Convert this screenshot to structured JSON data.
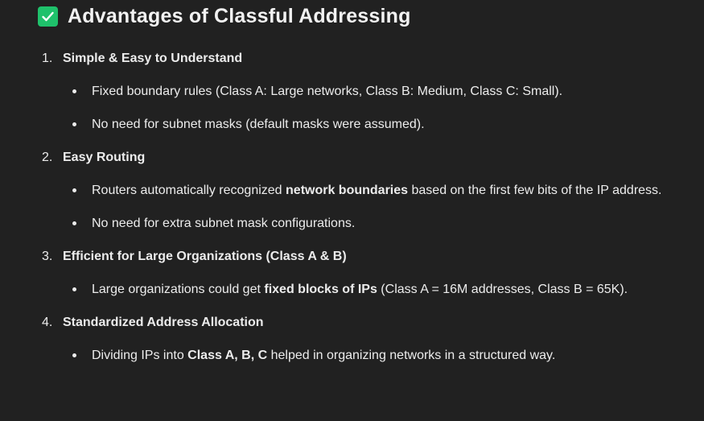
{
  "heading": {
    "icon": "check-mark-button-icon",
    "text": "Advantages of Classful Addressing",
    "icon_color": "#1fc16b"
  },
  "items": [
    {
      "number": "1.",
      "title": "Simple & Easy to Understand",
      "bullets": [
        [
          {
            "t": "Fixed boundary rules (Class A: Large networks, Class B: Medium, Class C: Small)."
          }
        ],
        [
          {
            "t": "No need for subnet masks (default masks were assumed)."
          }
        ]
      ]
    },
    {
      "number": "2.",
      "title": "Easy Routing",
      "bullets": [
        [
          {
            "t": "Routers automatically recognized "
          },
          {
            "t": "network boundaries",
            "b": true
          },
          {
            "t": " based on the first few bits of the IP address."
          }
        ],
        [
          {
            "t": "No need for extra subnet mask configurations."
          }
        ]
      ]
    },
    {
      "number": "3.",
      "title": "Efficient for Large Organizations (Class A & B)",
      "bullets": [
        [
          {
            "t": "Large organizations could get "
          },
          {
            "t": "fixed blocks of IPs",
            "b": true
          },
          {
            "t": " (Class A = 16M addresses, Class B = 65K)."
          }
        ]
      ]
    },
    {
      "number": "4.",
      "title": "Standardized Address Allocation",
      "bullets": [
        [
          {
            "t": "Dividing IPs into "
          },
          {
            "t": "Class A, B, C",
            "b": true
          },
          {
            "t": " helped in organizing networks in a structured way."
          }
        ]
      ]
    }
  ]
}
